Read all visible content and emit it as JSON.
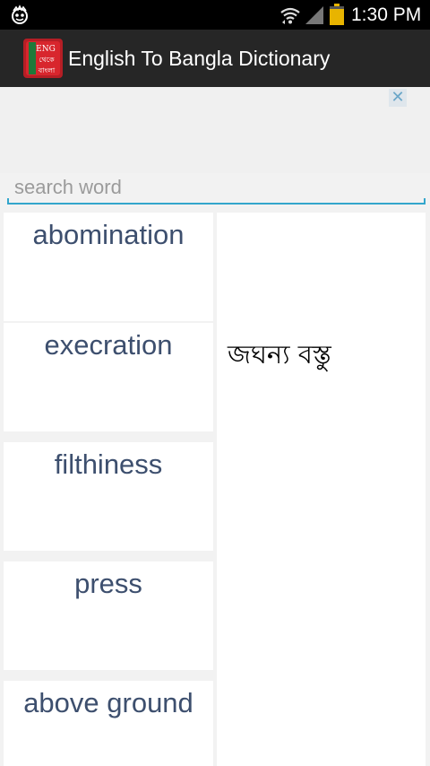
{
  "status_bar": {
    "time": "1:30 PM",
    "left_icon": "notification-app-icon",
    "icons": [
      "wifi-icon",
      "signal-icon",
      "battery-icon"
    ]
  },
  "app": {
    "title": "English To Bangla Dictionary",
    "icon_text_top": "ENG",
    "icon_text_mid": "থেকে",
    "icon_text_bottom": "বাংলা"
  },
  "ad": {
    "close_label": "✕"
  },
  "search": {
    "placeholder": "search word",
    "value": ""
  },
  "words": [
    {
      "label": "abomination"
    },
    {
      "label": "execration"
    },
    {
      "label": "filthiness"
    },
    {
      "label": "press"
    },
    {
      "label": "above ground"
    }
  ],
  "meaning": {
    "text": "জঘন্য বস্তু"
  },
  "colors": {
    "action_bar": "#262626",
    "accent": "#33a6cc",
    "word_text": "#3d4f6e"
  }
}
